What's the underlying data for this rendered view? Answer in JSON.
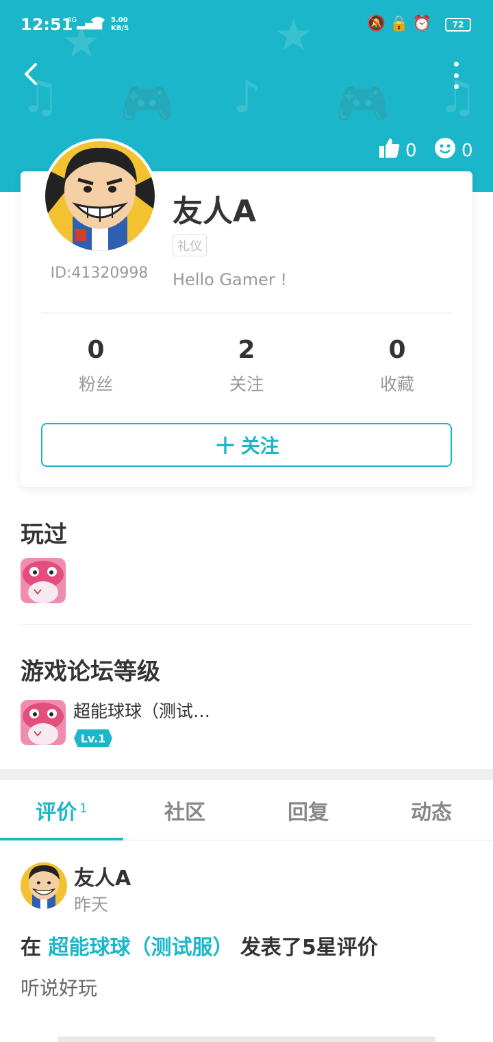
{
  "status_bar": {
    "time": "12:51",
    "network": "4G",
    "speed_value": "5.00",
    "speed_unit": "KB/S",
    "battery": "72"
  },
  "header": {
    "likes_count": "0",
    "smiles_count": "0"
  },
  "profile": {
    "name": "友人A",
    "tag": "礼仪",
    "id_text": "ID:41320998",
    "bio": "Hello Gamer !",
    "stats": [
      {
        "value": "0",
        "label": "粉丝"
      },
      {
        "value": "2",
        "label": "关注"
      },
      {
        "value": "0",
        "label": "收藏"
      }
    ],
    "follow_label": "关注"
  },
  "played": {
    "title": "玩过"
  },
  "forum_level": {
    "title": "游戏论坛等级",
    "game_name": "超能球球（测试…",
    "level": "Lv.1"
  },
  "tabs": [
    {
      "label": "评价",
      "count": "1",
      "active": true
    },
    {
      "label": "社区"
    },
    {
      "label": "回复"
    },
    {
      "label": "动态"
    }
  ],
  "post": {
    "author": "友人A",
    "time": "昨天",
    "prefix": "在",
    "game": "超能球球（测试服）",
    "suffix": "发表了5星评价",
    "text": "听说好玩"
  },
  "colors": {
    "accent": "#1bb6c9"
  }
}
